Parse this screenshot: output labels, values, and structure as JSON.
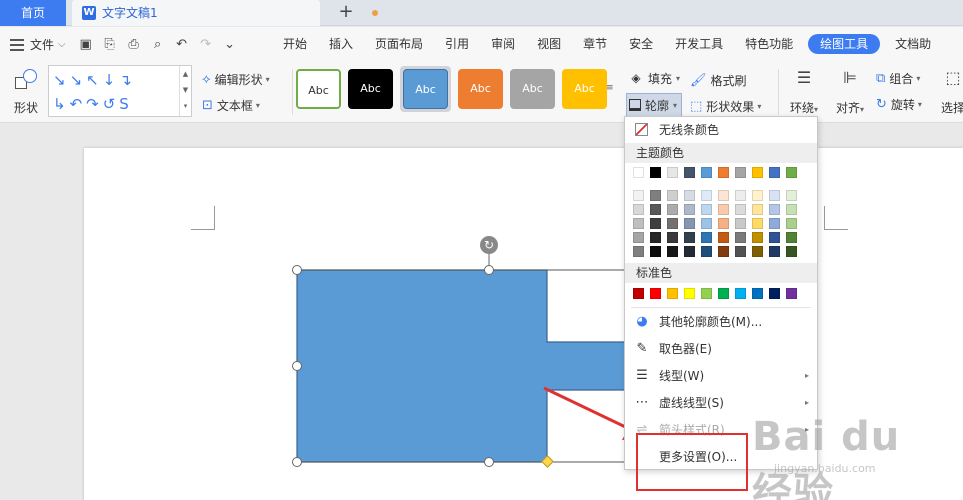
{
  "tabs": {
    "home": "首页",
    "document": "文字文稿1",
    "add": "+"
  },
  "menubar": {
    "file": "文件",
    "items": [
      "开始",
      "插入",
      "页面布局",
      "引用",
      "审阅",
      "视图",
      "章节",
      "安全",
      "开发工具",
      "特色功能",
      "绘图工具",
      "文档助"
    ],
    "active_index": 10
  },
  "ribbon": {
    "shape_label": "形状",
    "gallery_row1": "↘↘↖↓↴",
    "gallery_row2": "↳↶↷↺S",
    "edit_shape": "编辑形状",
    "text_box": "文本框",
    "style_text": "Abc",
    "fill": "填充",
    "outline": "轮廓",
    "format_brush": "格式刷",
    "shape_effect": "形状效果",
    "wrap": "环绕",
    "align": "对齐",
    "group": "组合",
    "rotate": "旋转",
    "select": "选择"
  },
  "style_colors": {
    "s1_bg": "#ffffff",
    "s1_border": "#70ad47",
    "s2_bg": "#000000",
    "s3_bg": "#5b9bd5",
    "s4_bg": "#ed7d31",
    "s5_bg": "#a5a5a5",
    "s6_bg": "#ffc000"
  },
  "dropdown": {
    "no_outline": "无线条颜色",
    "theme_colors_header": "主题颜色",
    "theme_top_row": [
      "#ffffff",
      "#000000",
      "#e7e6e6",
      "#44546a",
      "#5b9bd5",
      "#ed7d31",
      "#a5a5a5",
      "#ffc000",
      "#4472c4",
      "#70ad47"
    ],
    "theme_shades": [
      [
        "#f2f2f2",
        "#7f7f7f",
        "#d0cece",
        "#d6dce4",
        "#deebf6",
        "#fbe5d5",
        "#ededed",
        "#fff2cc",
        "#d9e2f3",
        "#e2efd9"
      ],
      [
        "#d8d8d8",
        "#595959",
        "#aeabab",
        "#adb9ca",
        "#bdd7ee",
        "#f7cbac",
        "#dbdbdb",
        "#fee599",
        "#b4c6e7",
        "#c5e0b3"
      ],
      [
        "#bfbfbf",
        "#3f3f3f",
        "#757070",
        "#8496b0",
        "#9cc3e5",
        "#f4b183",
        "#c9c9c9",
        "#ffd965",
        "#8eaadb",
        "#a8d08d"
      ],
      [
        "#a5a5a5",
        "#262626",
        "#3a3838",
        "#323f4f",
        "#2e75b5",
        "#c55a11",
        "#7b7b7b",
        "#bf9000",
        "#2f5496",
        "#538135"
      ],
      [
        "#7f7f7f",
        "#0c0c0c",
        "#171616",
        "#222a35",
        "#1e4e79",
        "#833c0b",
        "#525252",
        "#7f6000",
        "#1f3864",
        "#375623"
      ]
    ],
    "standard_colors_header": "标准色",
    "standard_colors": [
      "#c00000",
      "#ff0000",
      "#ffc000",
      "#ffff00",
      "#92d050",
      "#00b050",
      "#00b0f0",
      "#0070c0",
      "#002060",
      "#7030a0"
    ],
    "other_outline": "其他轮廓颜色(M)...",
    "eyedropper": "取色器(E)",
    "line_type": "线型(W)",
    "dash_type": "虚线线型(S)",
    "arrow_style": "箭头样式(R)",
    "more_settings": "更多设置(O)..."
  },
  "watermark": {
    "main": "Bai du 经验",
    "sub": "jingyan.baidu.com"
  }
}
